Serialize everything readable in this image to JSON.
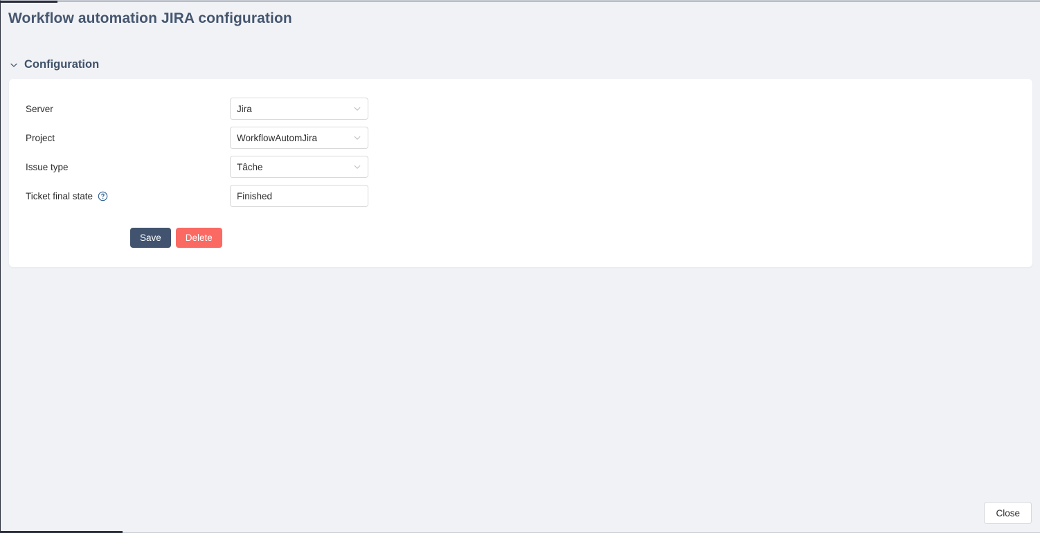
{
  "dialog": {
    "title": "Workflow automation JIRA configuration"
  },
  "section": {
    "title": "Configuration",
    "toggle_icon": "chevron-down-icon",
    "expanded": true
  },
  "form": {
    "fields": [
      {
        "label": "Server",
        "value": "Jira",
        "control": "select",
        "icon": "chevron-down-icon",
        "help": false
      },
      {
        "label": "Project",
        "value": "WorkflowAutomJira",
        "control": "select",
        "icon": "chevron-down-icon",
        "help": false
      },
      {
        "label": "Issue type",
        "value": "Tâche",
        "control": "select",
        "icon": "chevron-down-icon",
        "help": false
      },
      {
        "label": "Ticket final state",
        "value": "Finished",
        "control": "text",
        "icon": "",
        "help": true,
        "help_icon": "question-circle-icon"
      }
    ]
  },
  "actions": {
    "save_label": "Save",
    "delete_label": "Delete",
    "save_color": "#41536e",
    "delete_color": "#fa6a63"
  },
  "footer": {
    "close_label": "Close"
  },
  "theme": {
    "page_background": "#f1f2f6",
    "card_background": "#ffffff",
    "title_color": "#45566f",
    "label_color": "#2b2b2b",
    "field_border": "#d9d9d9",
    "help_icon_color": "#2a5b8f"
  }
}
